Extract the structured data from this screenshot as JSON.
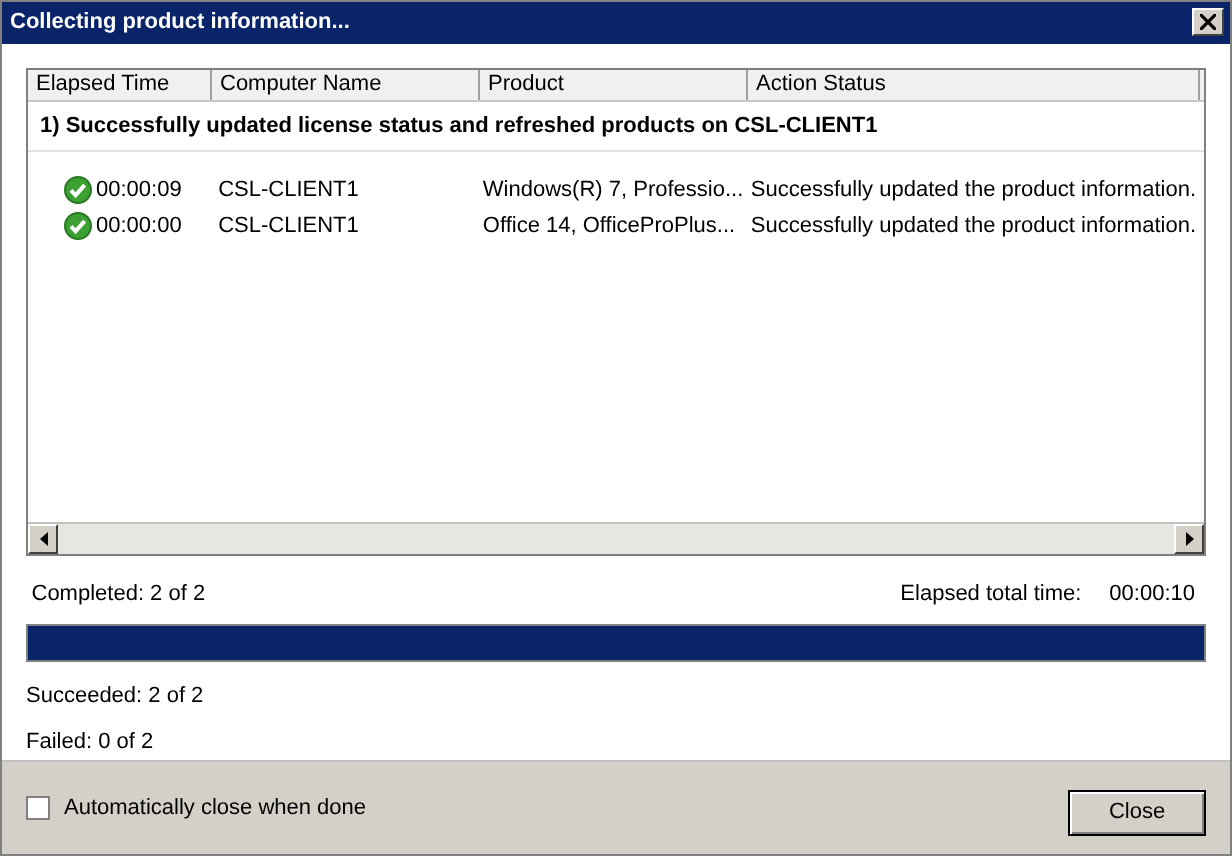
{
  "window": {
    "title": "Collecting product information..."
  },
  "table": {
    "columns": [
      "Elapsed Time",
      "Computer Name",
      "Product",
      "Action Status"
    ],
    "group": "1) Successfully updated license status and refreshed products on CSL-CLIENT1",
    "rows": [
      {
        "succeeded": true,
        "elapsed": "00:00:09",
        "computer": "CSL-CLIENT1",
        "product": "Windows(R) 7, Professio...",
        "action": "Successfully updated the product information."
      },
      {
        "succeeded": true,
        "elapsed": "00:00:00",
        "computer": "CSL-CLIENT1",
        "product": "Office 14, OfficeProPlus...",
        "action": "Successfully updated the product information."
      }
    ]
  },
  "progress": {
    "completed": "Completed: 2 of 2",
    "elapsed_label": "Elapsed total time:",
    "elapsed_value": "00:00:10",
    "level": 1
  },
  "summary": {
    "succeeded": "Succeeded: 2 of 2",
    "failed": "Failed: 0 of 2"
  },
  "footer": {
    "auto_close": {
      "label": "Automatically close when done",
      "checked": false
    },
    "close_button": "Close"
  }
}
